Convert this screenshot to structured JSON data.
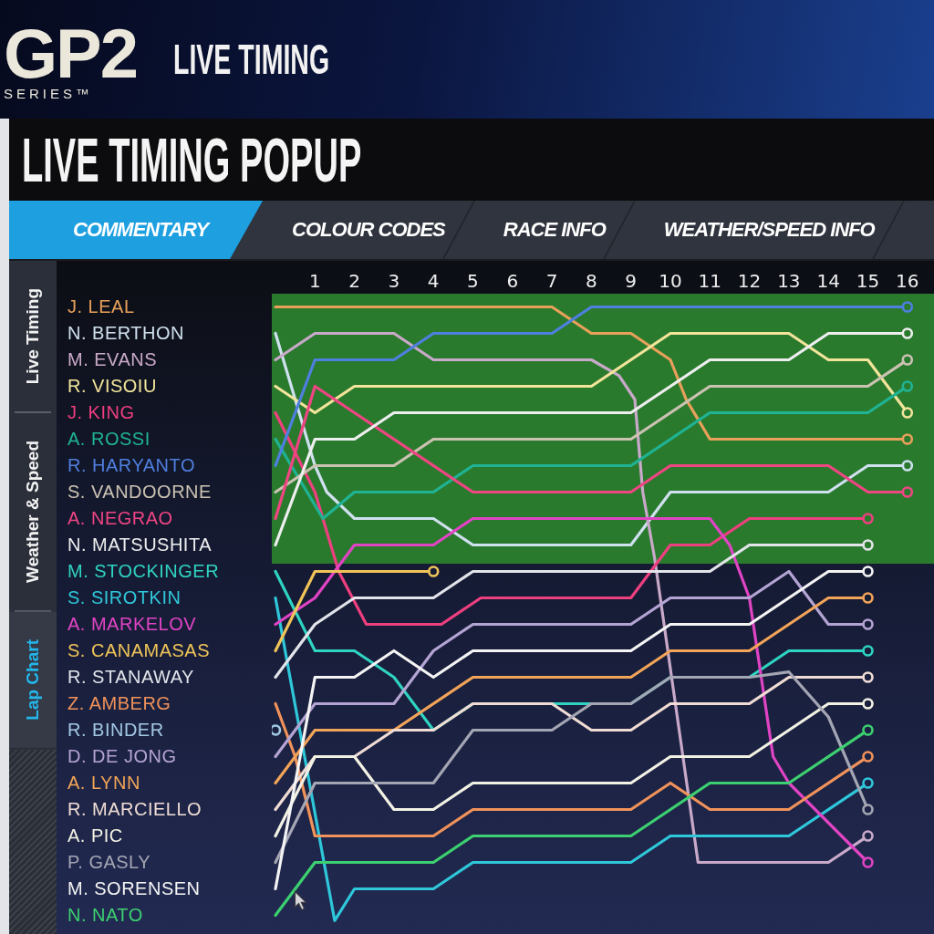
{
  "header": {
    "logo": {
      "mark": "GP2",
      "tagline": "SERIES™"
    },
    "title": "LIVE TIMING"
  },
  "popup": {
    "title": "LIVE TIMING POPUP"
  },
  "tabs": [
    {
      "label": "COMMENTARY",
      "selected": true
    },
    {
      "label": "COLOUR CODES",
      "selected": false
    },
    {
      "label": "RACE INFO",
      "selected": false
    },
    {
      "label": "WEATHER/SPEED INFO",
      "selected": false
    }
  ],
  "side_tabs": [
    {
      "label": "Live Timing",
      "selected": false
    },
    {
      "label": "Weather & Speed",
      "selected": false
    },
    {
      "label": "Lap Chart",
      "selected": true
    }
  ],
  "lap_chart": {
    "laps": [
      "1",
      "2",
      "3",
      "4",
      "5",
      "6",
      "7",
      "8",
      "9",
      "10",
      "11",
      "12",
      "13",
      "14",
      "15",
      "16"
    ],
    "drivers": [
      {
        "name": "J. LEAL",
        "color": "#e8a05a"
      },
      {
        "name": "N. BERTHON",
        "color": "#cfe0ef"
      },
      {
        "name": "M. EVANS",
        "color": "#c9a9c9"
      },
      {
        "name": "R. VISOIU",
        "color": "#f2e49a"
      },
      {
        "name": "J. KING",
        "color": "#ee3f7f"
      },
      {
        "name": "A. ROSSI",
        "color": "#1fb394"
      },
      {
        "name": "R. HARYANTO",
        "color": "#4f7fdf"
      },
      {
        "name": "S. VANDOORNE",
        "color": "#cbc2b2"
      },
      {
        "name": "A. NEGRAO",
        "color": "#ef4583"
      },
      {
        "name": "N. MATSUSHITA",
        "color": "#eeeeee"
      },
      {
        "name": "M. STOCKINGER",
        "color": "#2fd3c1"
      },
      {
        "name": "S. SIROTKIN",
        "color": "#2fc7da"
      },
      {
        "name": "A. MARKELOV",
        "color": "#e044c4"
      },
      {
        "name": "S. CANAMASAS",
        "color": "#f0c458"
      },
      {
        "name": "R. STANAWAY",
        "color": "#e2e4ea"
      },
      {
        "name": "Z. AMBERG",
        "color": "#f0925a"
      },
      {
        "name": "R. BINDER",
        "color": "#a2c8e4"
      },
      {
        "name": "D. DE JONG",
        "color": "#b4a4d4"
      },
      {
        "name": "A. LYNN",
        "color": "#f2a458"
      },
      {
        "name": "R. MARCIELLO",
        "color": "#f0dcd4"
      },
      {
        "name": "A. PIC",
        "color": "#f2f2e4"
      },
      {
        "name": "P. GASLY",
        "color": "#a4a6b4"
      },
      {
        "name": "M. SORENSEN",
        "color": "#f4f4f4"
      },
      {
        "name": "N. NATO",
        "color": "#3cd070"
      }
    ]
  }
}
